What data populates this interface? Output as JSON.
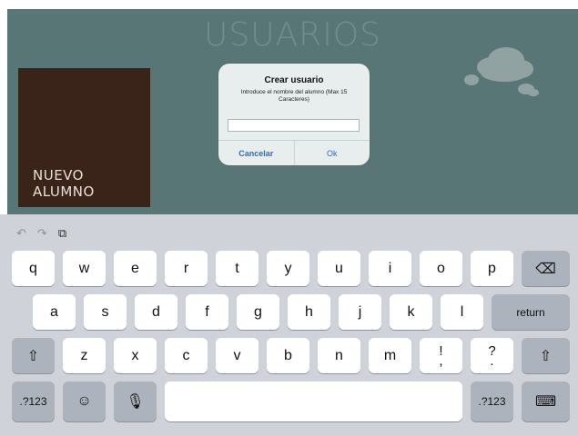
{
  "app": {
    "title": "USUARIOS",
    "tile_label": "NUEVO ALUMNO"
  },
  "dialog": {
    "title": "Crear usuario",
    "message": "Introduce el nombre del alumno (Max 15 Caracteres)",
    "input_value": "",
    "cancel_label": "Cancelar",
    "ok_label": "Ok"
  },
  "keyboard": {
    "shortcuts": {
      "undo": "↶",
      "redo": "↷",
      "paste": "⧉"
    },
    "row1": [
      "q",
      "w",
      "e",
      "r",
      "t",
      "y",
      "u",
      "i",
      "o",
      "p"
    ],
    "row2": [
      "a",
      "s",
      "d",
      "f",
      "g",
      "h",
      "j",
      "k",
      "l"
    ],
    "row3": [
      "z",
      "x",
      "c",
      "v",
      "b",
      "n",
      "m"
    ],
    "punct1": {
      "top": "!",
      "bottom": ","
    },
    "punct2": {
      "top": "?",
      "bottom": "."
    },
    "return_label": "return",
    "numbers_label": ".?123",
    "backspace_icon": "⌫",
    "shift_icon": "⇧",
    "emoji_icon": "☺",
    "mic_icon": "🎙",
    "hide_keyboard_icon": "⌨"
  }
}
